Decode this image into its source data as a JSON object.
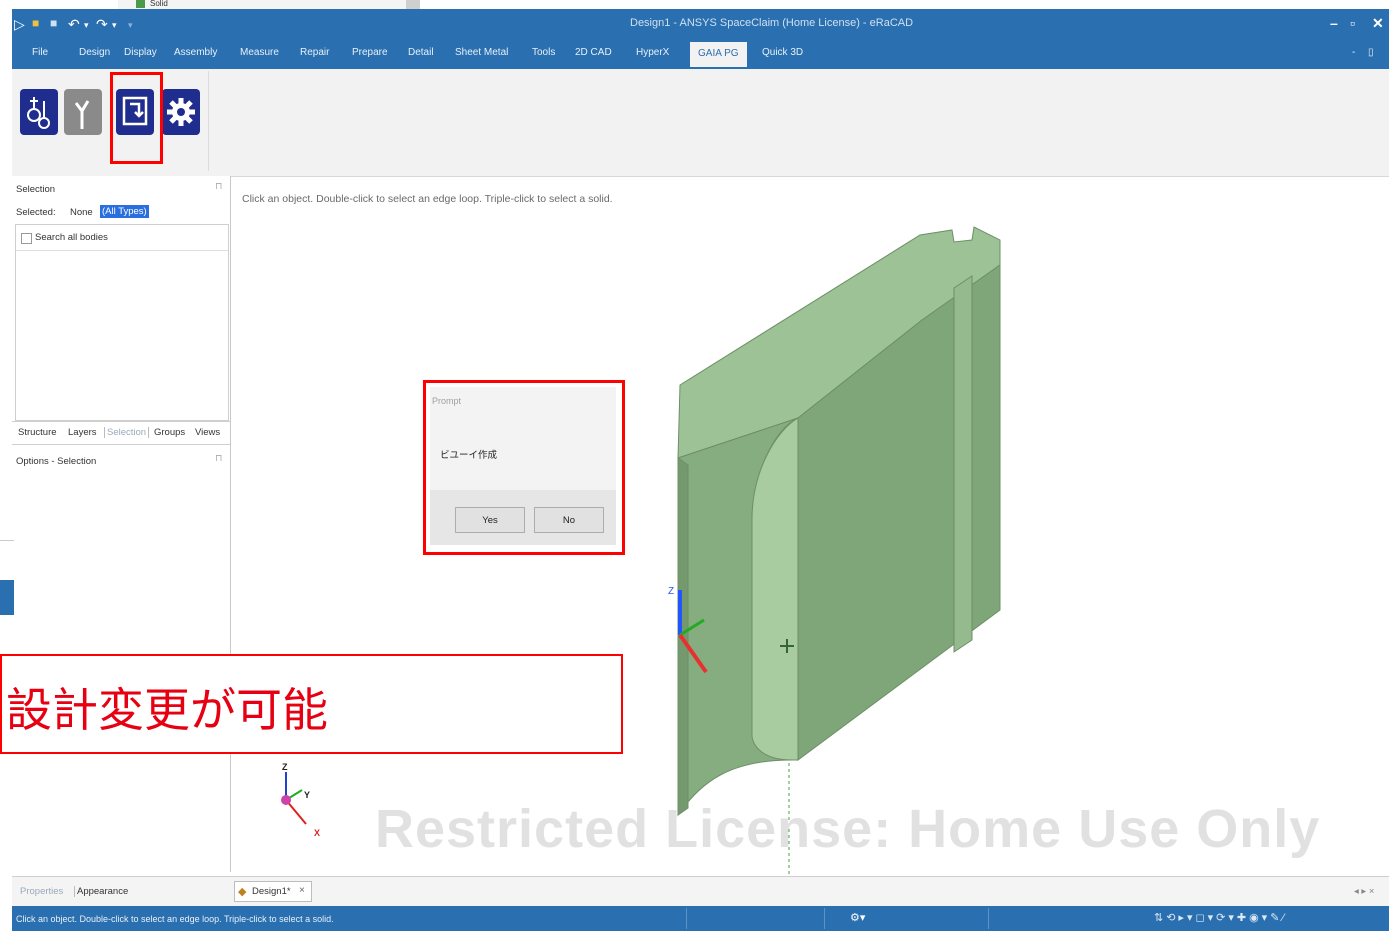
{
  "top_tree": {
    "item_label": "Solid"
  },
  "window": {
    "title": "Design1 - ANSYS SpaceClaim (Home License) - eRaCAD",
    "min_label": "–",
    "restore_label": "▫",
    "close_label": "✕"
  },
  "menu": {
    "items": [
      "File",
      "Design",
      "Display",
      "Assembly",
      "Measure",
      "Repair",
      "Prepare",
      "Detail",
      "Sheet Metal",
      "Tools",
      "2D CAD",
      "HyperX",
      "GAIA PG",
      "Quick 3D"
    ],
    "active": "GAIA PG"
  },
  "ribbon": {
    "buttons": [
      "bulb-tool",
      "branch-tool",
      "export-tool",
      "settings-gear"
    ],
    "highlighted": "export-tool"
  },
  "selection_panel": {
    "title": "Selection",
    "selected_label": "Selected:",
    "selected_value": "None",
    "type_filter": "(All Types)",
    "search_all_bodies": "Search all bodies",
    "tabs": [
      "Structure",
      "Layers",
      "Selection",
      "Groups",
      "Views"
    ],
    "active_tab": "Selection",
    "options_title": "Options - Selection"
  },
  "viewport": {
    "hint": "Click an object. Double-click to select an edge loop. Triple-click to select a solid.",
    "watermark": "Restricted License: Home Use Only",
    "axis_labels": {
      "z": "Z",
      "y": "Y",
      "x": "X"
    },
    "model_color": "#8fb58a"
  },
  "dialog": {
    "title": "Prompt",
    "message": "ビユーイ作成",
    "yes_label": "Yes",
    "no_label": "No"
  },
  "callout": {
    "text": "設計変更が可能"
  },
  "bottom": {
    "left_tabs": [
      "Properties",
      "Appearance"
    ],
    "doc_tab": "Design1*",
    "doc_close": "×"
  },
  "status": {
    "text": "Click an object. Double-click to select an edge loop. Triple-click to select a solid."
  },
  "colors": {
    "accent": "#2a6fb0",
    "highlight": "#ff0000",
    "callout_text": "#e60012"
  }
}
